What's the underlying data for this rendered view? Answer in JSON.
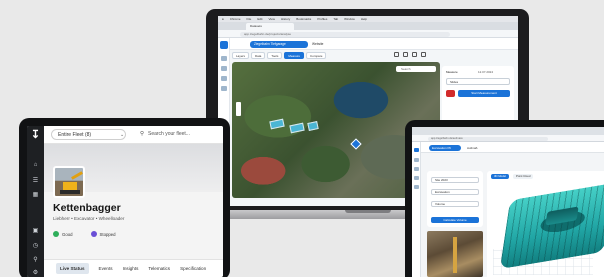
{
  "laptop": {
    "menubar": [
      "Chrome",
      "File",
      "Edit",
      "View",
      "History",
      "Bookmarks",
      "Profiles",
      "Tab",
      "Window",
      "Help"
    ],
    "browser_tab": "Datasets",
    "url": "app.ziegelbahn.de/projects/analyse",
    "project_pill": "Ziegelbahn Tiefgarage",
    "breadcrumb": "Website",
    "toolbar": [
      "Layers",
      "Data",
      "Tools",
      "Measure",
      "Compare"
    ],
    "active_tool": "Measure",
    "map_search_placeholder": "Search",
    "panel_title": "Measure",
    "panel_date": "12.07.2024",
    "panel_select": "Slides",
    "panel_button": "Start Measurement"
  },
  "tablet_left": {
    "fleet_select": "Entire Fleet (8)",
    "search_placeholder": "Search your fleet...",
    "machine_name": "Kettenbagger",
    "machine_subtitle": "Liebherr • Excavator • Wheelloader",
    "statuses": [
      {
        "label": "Good",
        "color": "#2eae5a"
      },
      {
        "label": "Stopped",
        "color": "#6a4fd6"
      }
    ],
    "tabs": [
      "Live Status",
      "Events",
      "Insights",
      "Telematics",
      "Specification"
    ],
    "active_tab": "Live Status"
  },
  "tablet_right": {
    "url": "app.ziegelbahn.de/aufmass",
    "project_pill": "Excavation Pit",
    "breadcrumb": "Aufmaß",
    "fields": [
      "Site 2023",
      "Excavation",
      "Volume"
    ],
    "button": "Calculate Volume",
    "view_tabs": [
      "3D Model",
      "Point Cloud"
    ],
    "active_view": "3D Model"
  },
  "colors": {
    "accent": "#1b73d8",
    "alert": "#d22b2b",
    "scan_teal": "#21a6a5"
  }
}
